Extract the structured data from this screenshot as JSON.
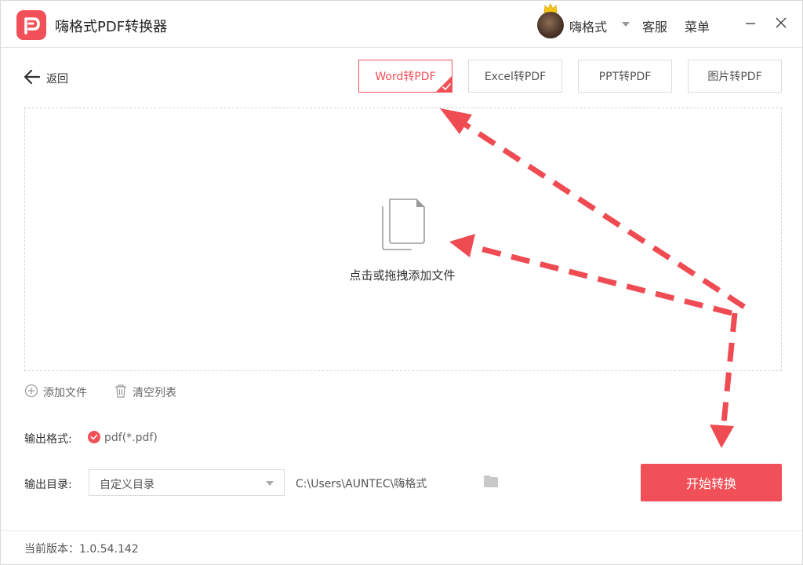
{
  "app": {
    "title": "嗨格式PDF转换器",
    "user_name": "嗨格式",
    "support_label": "客服",
    "menu_label": "菜单"
  },
  "nav": {
    "back_label": "返回",
    "tabs": [
      {
        "label": "Word转PDF",
        "active": true
      },
      {
        "label": "Excel转PDF",
        "active": false
      },
      {
        "label": "PPT转PDF",
        "active": false
      },
      {
        "label": "图片转PDF",
        "active": false
      }
    ]
  },
  "dropzone": {
    "prompt": "点击或拖拽添加文件"
  },
  "list_actions": {
    "add_file": "添加文件",
    "clear_list": "清空列表"
  },
  "output": {
    "format_label": "输出格式:",
    "format_value": "pdf(*.pdf)",
    "dir_label": "输出目录:",
    "dir_option": "自定义目录",
    "dir_path": "C:\\Users\\AUNTEC\\嗨格式",
    "start_label": "开始转换"
  },
  "footer": {
    "version_text": "当前版本：1.0.54.142"
  },
  "colors": {
    "accent": "#f25058",
    "annotation_arrow": "#ef4b53"
  }
}
